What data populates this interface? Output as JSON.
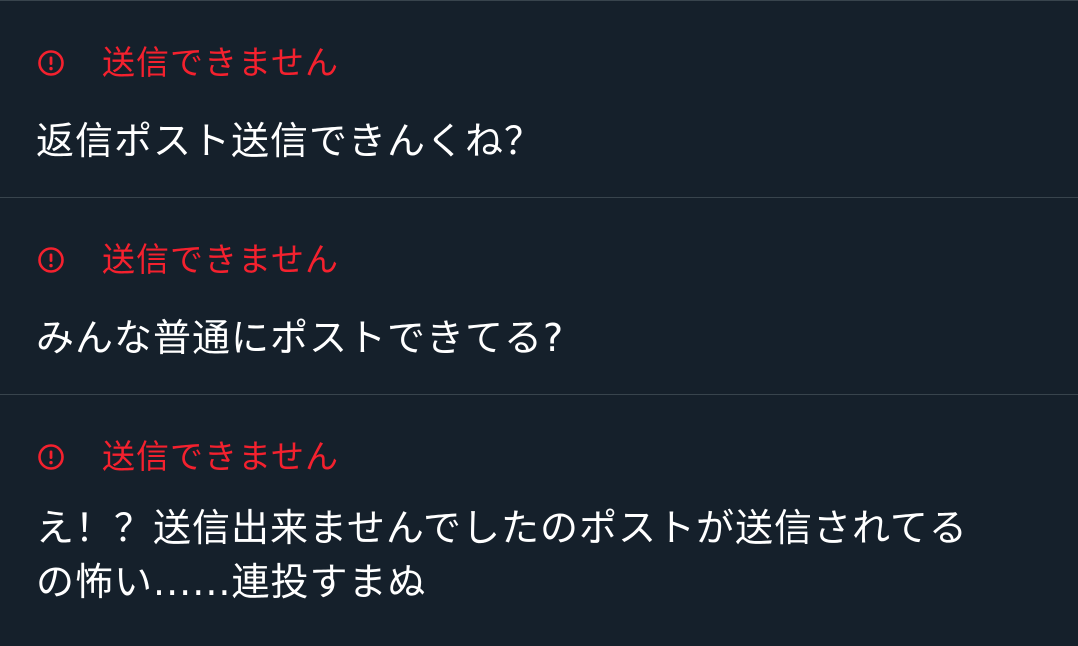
{
  "colors": {
    "background": "#15202b",
    "divider": "#38444d",
    "error": "#f4212e",
    "text": "#ffffff"
  },
  "posts": [
    {
      "status_icon": "error-circle-icon",
      "status_label": "送信できません",
      "text": "返信ポスト送信できんくね？"
    },
    {
      "status_icon": "error-circle-icon",
      "status_label": "送信できません",
      "text": "みんな普通にポストできてる?"
    },
    {
      "status_icon": "error-circle-icon",
      "status_label": "送信できません",
      "text": "え！？送信出来ませんでしたのポストが送信されてる\nの怖い......連投すまぬ"
    }
  ]
}
